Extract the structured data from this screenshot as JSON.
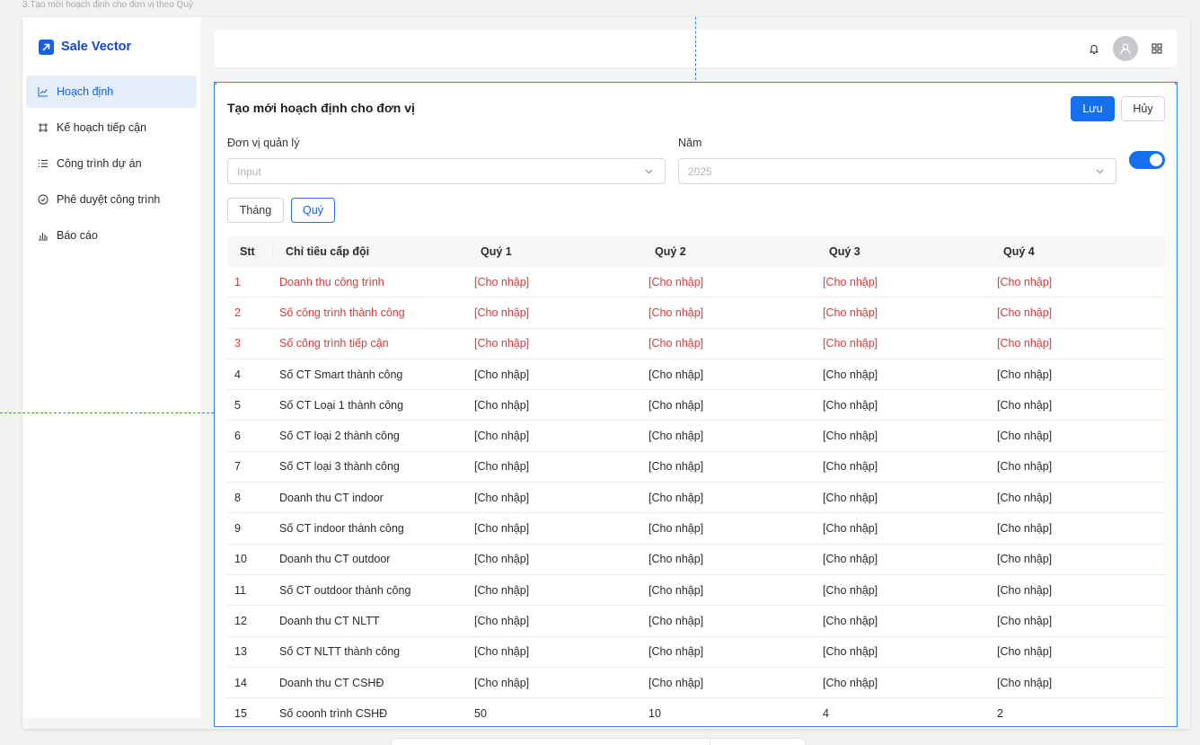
{
  "frame_caption": "3.Tạo mới hoạch định cho đơn vị theo Quý",
  "app": {
    "logo_text": "Sale Vector",
    "brand_color": "#1660f0",
    "accent_color": "#1570ef",
    "required_row_color": "#d63c3c"
  },
  "sidebar": {
    "items": [
      {
        "label": "Hoạch định",
        "icon": "line-chart-icon",
        "active": true
      },
      {
        "label": "Kế hoạch tiếp cận",
        "icon": "frame-icon",
        "active": false
      },
      {
        "label": "Công trình dự án",
        "icon": "list-icon",
        "active": false
      },
      {
        "label": "Phê duyệt công trình",
        "icon": "check-circle-icon",
        "active": false
      },
      {
        "label": "Báo cáo",
        "icon": "bar-chart-icon",
        "active": false
      }
    ]
  },
  "topbar": {
    "icons": [
      "bell-icon",
      "user-avatar-icon",
      "apps-grid-icon"
    ]
  },
  "form": {
    "title": "Tạo mới hoạch định cho đơn vị",
    "save_label": "Lưu",
    "cancel_label": "Hủy",
    "unit_label": "Đơn vị quản lý",
    "unit_placeholder": "Input",
    "year_label": "Năm",
    "year_value": "2025",
    "toggle_on": true,
    "period_month": "Tháng",
    "period_quarter": "Quý",
    "selected_period": "Quý"
  },
  "table": {
    "headers": {
      "stt": "Stt",
      "name": "Chỉ tiêu cấp đội",
      "q1": "Quý 1",
      "q2": "Quý 2",
      "q3": "Quý 3",
      "q4": "Quý 4"
    },
    "rows": [
      {
        "stt": "1",
        "name": "Doanh thu công trình",
        "q1": "[Cho nhập]",
        "q2": "[Cho nhập]",
        "q3": "[Cho nhập]",
        "q4": "[Cho nhập]",
        "required": true
      },
      {
        "stt": "2",
        "name": "Số công trình thành công",
        "q1": "[Cho nhập]",
        "q2": "[Cho nhập]",
        "q3": "[Cho nhập]",
        "q4": "[Cho nhập]",
        "required": true
      },
      {
        "stt": "3",
        "name": "Số công trình tiếp cận",
        "q1": "[Cho nhập]",
        "q2": "[Cho nhập]",
        "q3": "[Cho nhập]",
        "q4": "[Cho nhập]",
        "required": true
      },
      {
        "stt": "4",
        "name": "Số CT Smart thành công",
        "q1": "[Cho nhập]",
        "q2": "[Cho nhập]",
        "q3": "[Cho nhập]",
        "q4": "[Cho nhập]",
        "required": false
      },
      {
        "stt": "5",
        "name": "Số CT Loại 1 thành công",
        "q1": "[Cho nhập]",
        "q2": "[Cho nhập]",
        "q3": "[Cho nhập]",
        "q4": "[Cho nhập]",
        "required": false
      },
      {
        "stt": "6",
        "name": "Số CT loại 2 thành công",
        "q1": "[Cho nhập]",
        "q2": "[Cho nhập]",
        "q3": "[Cho nhập]",
        "q4": "[Cho nhập]",
        "required": false
      },
      {
        "stt": "7",
        "name": "Số CT loại 3 thành công",
        "q1": "[Cho nhập]",
        "q2": "[Cho nhập]",
        "q3": "[Cho nhập]",
        "q4": "[Cho nhập]",
        "required": false
      },
      {
        "stt": "8",
        "name": "Doanh thu CT indoor",
        "q1": "[Cho nhập]",
        "q2": "[Cho nhập]",
        "q3": "[Cho nhập]",
        "q4": "[Cho nhập]",
        "required": false
      },
      {
        "stt": "9",
        "name": "Số CT indoor thành công",
        "q1": "[Cho nhập]",
        "q2": "[Cho nhập]",
        "q3": "[Cho nhập]",
        "q4": "[Cho nhập]",
        "required": false
      },
      {
        "stt": "10",
        "name": "Doanh thu CT outdoor",
        "q1": "[Cho nhập]",
        "q2": "[Cho nhập]",
        "q3": "[Cho nhập]",
        "q4": "[Cho nhập]",
        "required": false
      },
      {
        "stt": "11",
        "name": "Số CT outdoor thành công",
        "q1": "[Cho nhập]",
        "q2": "[Cho nhập]",
        "q3": "[Cho nhập]",
        "q4": "[Cho nhập]",
        "required": false
      },
      {
        "stt": "12",
        "name": "Doanh thu CT NLTT",
        "q1": "[Cho nhập]",
        "q2": "[Cho nhập]",
        "q3": "[Cho nhập]",
        "q4": "[Cho nhập]",
        "required": false
      },
      {
        "stt": "13",
        "name": "Số CT NLTT thành công",
        "q1": "[Cho nhập]",
        "q2": "[Cho nhập]",
        "q3": "[Cho nhập]",
        "q4": "[Cho nhập]",
        "required": false
      },
      {
        "stt": "14",
        "name": "Doanh thu CT CSHĐ",
        "q1": "[Cho nhập]",
        "q2": "[Cho nhập]",
        "q3": "[Cho nhập]",
        "q4": "[Cho nhập]",
        "required": false
      },
      {
        "stt": "15",
        "name": "Số coonh trình CSHĐ",
        "q1": "50",
        "q2": "10",
        "q3": "4",
        "q4": "2",
        "required": false
      }
    ]
  }
}
